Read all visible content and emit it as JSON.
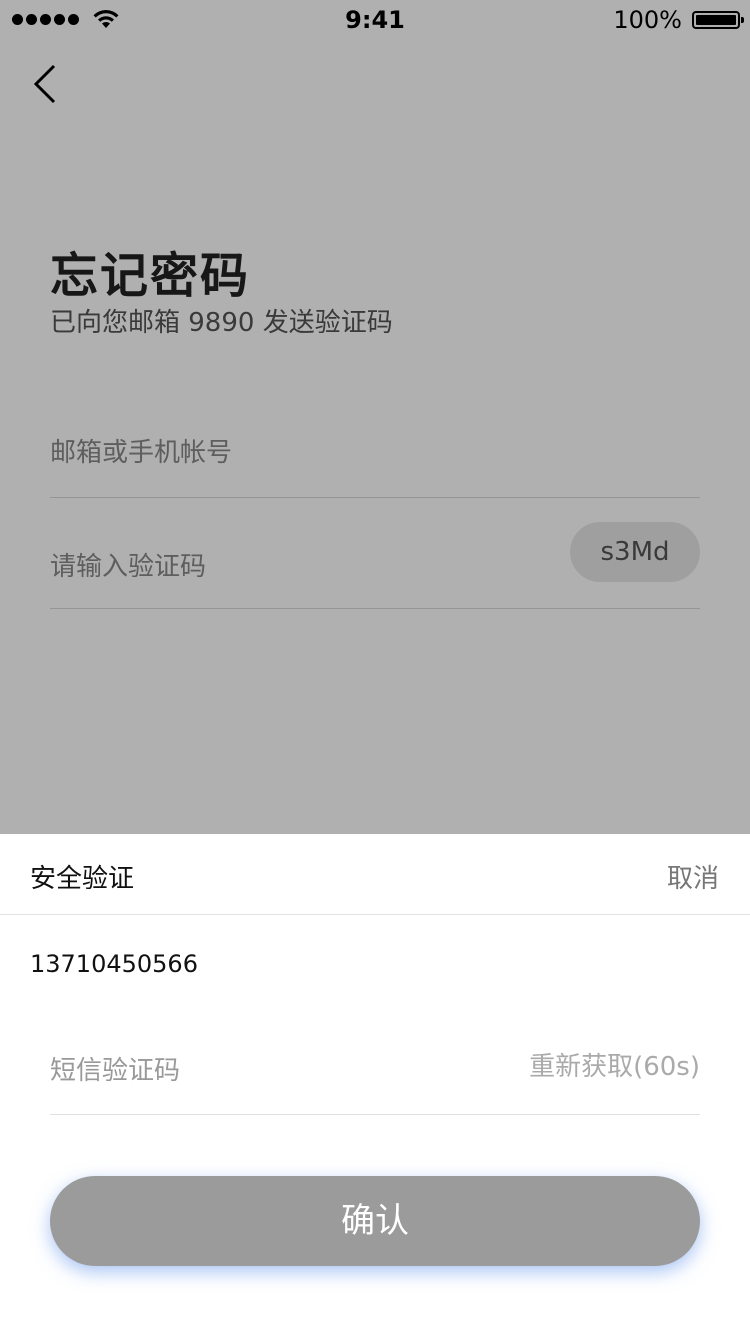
{
  "status_bar": {
    "time": "9:41",
    "battery_text": "100%",
    "battery_level": 1.0,
    "signal_dots": 5
  },
  "page": {
    "back_icon": "chevron-left-icon",
    "title": "忘记密码",
    "subtitle": "已向您邮箱 9890 发送验证码",
    "account_placeholder": "邮箱或手机帐号",
    "code_placeholder": "请输入验证码",
    "captcha": "s3Md"
  },
  "sheet": {
    "title": "安全验证",
    "cancel_label": "取消",
    "phone_number": "13710450566",
    "sms_placeholder": "短信验证码",
    "resend_label": "重新获取(60s)",
    "confirm_label": "确认"
  },
  "colors": {
    "confirm_bg": "#9b9b9b",
    "confirm_shadow": "#6496eb",
    "overlay": "#000000"
  }
}
